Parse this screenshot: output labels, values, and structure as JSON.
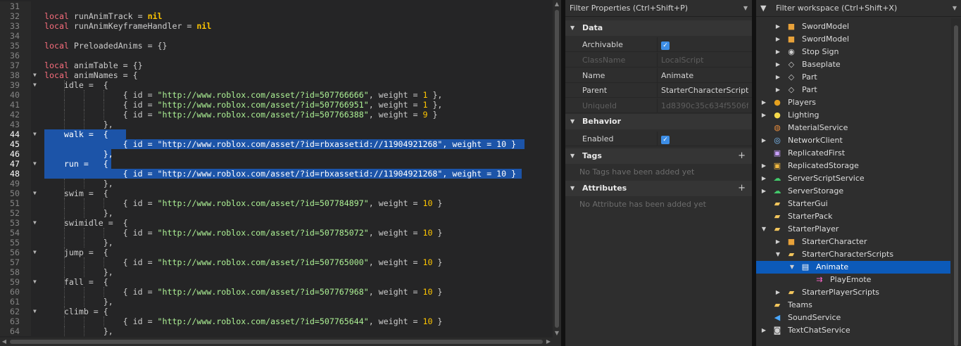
{
  "editor": {
    "lines": [
      {
        "n": "31",
        "fold": "",
        "indent": 0,
        "hl": false,
        "tokens": []
      },
      {
        "n": "32",
        "fold": "",
        "indent": 0,
        "hl": false,
        "tokens": [
          {
            "t": "local",
            "c": "kw"
          },
          {
            "t": " runAnimTrack = ",
            "c": ""
          },
          {
            "t": "nil",
            "c": "nil"
          }
        ]
      },
      {
        "n": "33",
        "fold": "",
        "indent": 0,
        "hl": false,
        "tokens": [
          {
            "t": "local",
            "c": "kw"
          },
          {
            "t": " runAnimKeyframeHandler = ",
            "c": ""
          },
          {
            "t": "nil",
            "c": "nil"
          }
        ]
      },
      {
        "n": "34",
        "fold": "",
        "indent": 0,
        "hl": false,
        "tokens": []
      },
      {
        "n": "35",
        "fold": "",
        "indent": 0,
        "hl": false,
        "tokens": [
          {
            "t": "local",
            "c": "kw"
          },
          {
            "t": " PreloadedAnims = {}",
            "c": ""
          }
        ]
      },
      {
        "n": "36",
        "fold": "",
        "indent": 0,
        "hl": false,
        "tokens": []
      },
      {
        "n": "37",
        "fold": "",
        "indent": 0,
        "hl": false,
        "tokens": [
          {
            "t": "local",
            "c": "kw"
          },
          {
            "t": " animTable = {}",
            "c": ""
          }
        ]
      },
      {
        "n": "38",
        "fold": "▼",
        "indent": 0,
        "hl": false,
        "tokens": [
          {
            "t": "local",
            "c": "kw"
          },
          {
            "t": " animNames = {",
            "c": ""
          }
        ]
      },
      {
        "n": "39",
        "fold": "▼",
        "indent": 1,
        "hl": false,
        "tokens": [
          {
            "t": "    idle =  {",
            "c": ""
          }
        ]
      },
      {
        "n": "40",
        "fold": "",
        "indent": 3,
        "hl": false,
        "tokens": [
          {
            "t": "                { id = ",
            "c": ""
          },
          {
            "t": "\"http://www.roblox.com/asset/?id=507766666\"",
            "c": "str"
          },
          {
            "t": ", weight = ",
            "c": ""
          },
          {
            "t": "1",
            "c": "num"
          },
          {
            "t": " },",
            "c": ""
          }
        ]
      },
      {
        "n": "41",
        "fold": "",
        "indent": 3,
        "hl": false,
        "tokens": [
          {
            "t": "                { id = ",
            "c": ""
          },
          {
            "t": "\"http://www.roblox.com/asset/?id=507766951\"",
            "c": "str"
          },
          {
            "t": ", weight = ",
            "c": ""
          },
          {
            "t": "1",
            "c": "num"
          },
          {
            "t": " },",
            "c": ""
          }
        ]
      },
      {
        "n": "42",
        "fold": "",
        "indent": 3,
        "hl": false,
        "tokens": [
          {
            "t": "                { id = ",
            "c": ""
          },
          {
            "t": "\"http://www.roblox.com/asset/?id=507766388\"",
            "c": "str"
          },
          {
            "t": ", weight = ",
            "c": ""
          },
          {
            "t": "9",
            "c": "num"
          },
          {
            "t": " }",
            "c": ""
          }
        ]
      },
      {
        "n": "43",
        "fold": "",
        "indent": 2,
        "hl": false,
        "tokens": [
          {
            "t": "            },",
            "c": ""
          }
        ]
      },
      {
        "n": "44",
        "fold": "▼",
        "indent": 0,
        "hl": true,
        "hlw": 116,
        "tokens": [
          {
            "t": "    walk =  {",
            "c": ""
          }
        ]
      },
      {
        "n": "45",
        "fold": "",
        "indent": 0,
        "hl": true,
        "hlw": 682,
        "tokens": [
          {
            "t": "                { id = \"http://www.roblox.com/asset/?id=rbxassetid://11904921268\", weight = 10 }",
            "c": ""
          }
        ]
      },
      {
        "n": "46",
        "fold": "",
        "indent": 0,
        "hl": true,
        "hlw": 95,
        "tokens": [
          {
            "t": "            },",
            "c": ""
          }
        ]
      },
      {
        "n": "47",
        "fold": "▼",
        "indent": 0,
        "hl": true,
        "hlw": 95,
        "tokens": [
          {
            "t": "    run =   {",
            "c": ""
          }
        ]
      },
      {
        "n": "48",
        "fold": "",
        "indent": 0,
        "hl": true,
        "hlw": 678,
        "tokens": [
          {
            "t": "                { id = \"http://www.roblox.com/asset/?id=rbxassetid://11904921268\", weight = 10 }",
            "c": ""
          }
        ]
      },
      {
        "n": "49",
        "fold": "",
        "indent": 2,
        "hl": false,
        "tokens": [
          {
            "t": "            },",
            "c": ""
          }
        ]
      },
      {
        "n": "50",
        "fold": "▼",
        "indent": 1,
        "hl": false,
        "tokens": [
          {
            "t": "    swim =  {",
            "c": ""
          }
        ]
      },
      {
        "n": "51",
        "fold": "",
        "indent": 3,
        "hl": false,
        "tokens": [
          {
            "t": "                { id = ",
            "c": ""
          },
          {
            "t": "\"http://www.roblox.com/asset/?id=507784897\"",
            "c": "str"
          },
          {
            "t": ", weight = ",
            "c": ""
          },
          {
            "t": "10",
            "c": "num"
          },
          {
            "t": " }",
            "c": ""
          }
        ]
      },
      {
        "n": "52",
        "fold": "",
        "indent": 2,
        "hl": false,
        "tokens": [
          {
            "t": "            },",
            "c": ""
          }
        ]
      },
      {
        "n": "53",
        "fold": "▼",
        "indent": 1,
        "hl": false,
        "tokens": [
          {
            "t": "    swimidle =  {",
            "c": ""
          }
        ]
      },
      {
        "n": "54",
        "fold": "",
        "indent": 3,
        "hl": false,
        "tokens": [
          {
            "t": "                { id = ",
            "c": ""
          },
          {
            "t": "\"http://www.roblox.com/asset/?id=507785072\"",
            "c": "str"
          },
          {
            "t": ", weight = ",
            "c": ""
          },
          {
            "t": "10",
            "c": "num"
          },
          {
            "t": " }",
            "c": ""
          }
        ]
      },
      {
        "n": "55",
        "fold": "",
        "indent": 2,
        "hl": false,
        "tokens": [
          {
            "t": "            },",
            "c": ""
          }
        ]
      },
      {
        "n": "56",
        "fold": "▼",
        "indent": 1,
        "hl": false,
        "tokens": [
          {
            "t": "    jump =  {",
            "c": ""
          }
        ]
      },
      {
        "n": "57",
        "fold": "",
        "indent": 3,
        "hl": false,
        "tokens": [
          {
            "t": "                { id = ",
            "c": ""
          },
          {
            "t": "\"http://www.roblox.com/asset/?id=507765000\"",
            "c": "str"
          },
          {
            "t": ", weight = ",
            "c": ""
          },
          {
            "t": "10",
            "c": "num"
          },
          {
            "t": " }",
            "c": ""
          }
        ]
      },
      {
        "n": "58",
        "fold": "",
        "indent": 2,
        "hl": false,
        "tokens": [
          {
            "t": "            },",
            "c": ""
          }
        ]
      },
      {
        "n": "59",
        "fold": "▼",
        "indent": 1,
        "hl": false,
        "tokens": [
          {
            "t": "    fall =  {",
            "c": ""
          }
        ]
      },
      {
        "n": "60",
        "fold": "",
        "indent": 3,
        "hl": false,
        "tokens": [
          {
            "t": "                { id = ",
            "c": ""
          },
          {
            "t": "\"http://www.roblox.com/asset/?id=507767968\"",
            "c": "str"
          },
          {
            "t": ", weight = ",
            "c": ""
          },
          {
            "t": "10",
            "c": "num"
          },
          {
            "t": " }",
            "c": ""
          }
        ]
      },
      {
        "n": "61",
        "fold": "",
        "indent": 2,
        "hl": false,
        "tokens": [
          {
            "t": "            },",
            "c": ""
          }
        ]
      },
      {
        "n": "62",
        "fold": "▼",
        "indent": 1,
        "hl": false,
        "tokens": [
          {
            "t": "    climb = {",
            "c": ""
          }
        ]
      },
      {
        "n": "63",
        "fold": "",
        "indent": 3,
        "hl": false,
        "tokens": [
          {
            "t": "                { id = ",
            "c": ""
          },
          {
            "t": "\"http://www.roblox.com/asset/?id=507765644\"",
            "c": "str"
          },
          {
            "t": ", weight = ",
            "c": ""
          },
          {
            "t": "10",
            "c": "num"
          },
          {
            "t": " }",
            "c": ""
          }
        ]
      },
      {
        "n": "64",
        "fold": "",
        "indent": 2,
        "hl": false,
        "tokens": [
          {
            "t": "            },",
            "c": ""
          }
        ]
      }
    ]
  },
  "properties": {
    "filter_placeholder": "Filter Properties (Ctrl+Shift+P)",
    "sections": {
      "data": "Data",
      "behavior": "Behavior",
      "tags": "Tags",
      "attributes": "Attributes"
    },
    "rows": {
      "archivable": {
        "name": "Archivable",
        "checked": true
      },
      "classname": {
        "name": "ClassName",
        "value": "LocalScript"
      },
      "name": {
        "name": "Name",
        "value": "Animate"
      },
      "parent": {
        "name": "Parent",
        "value": "StarterCharacterScripts"
      },
      "uniqueid": {
        "name": "UniqueId",
        "value": "1d8390c35c634f5506f..."
      },
      "enabled": {
        "name": "Enabled",
        "checked": true
      }
    },
    "tags_empty": "No Tags have been added yet",
    "attributes_empty": "No Attribute has been added yet"
  },
  "explorer": {
    "filter_placeholder": "Filter workspace (Ctrl+Shift+X)",
    "items": [
      {
        "label": "SwordModel",
        "depth": 1,
        "arrow": "▶",
        "icon": "model-icon",
        "glyph": "■",
        "color": "#e8a23a"
      },
      {
        "label": "SwordModel",
        "depth": 1,
        "arrow": "▶",
        "icon": "model-icon",
        "glyph": "■",
        "color": "#e8a23a"
      },
      {
        "label": "Stop Sign",
        "depth": 1,
        "arrow": "▶",
        "icon": "union-icon",
        "glyph": "◉",
        "color": "#cfcfcf"
      },
      {
        "label": "Baseplate",
        "depth": 1,
        "arrow": "▶",
        "icon": "part-icon",
        "glyph": "◇",
        "color": "#cfcfcf"
      },
      {
        "label": "Part",
        "depth": 1,
        "arrow": "▶",
        "icon": "part-icon",
        "glyph": "◇",
        "color": "#cfcfcf"
      },
      {
        "label": "Part",
        "depth": 1,
        "arrow": "▶",
        "icon": "part-icon",
        "glyph": "◇",
        "color": "#cfcfcf"
      },
      {
        "label": "Players",
        "depth": 0,
        "arrow": "▶",
        "icon": "players-icon",
        "glyph": "●",
        "color": "#e6a11f"
      },
      {
        "label": "Lighting",
        "depth": 0,
        "arrow": "▶",
        "icon": "lightbulb-icon",
        "glyph": "●",
        "color": "#f5d94a"
      },
      {
        "label": "MaterialService",
        "depth": 0,
        "arrow": "",
        "icon": "material-service-icon",
        "glyph": "◍",
        "color": "#e48a3c"
      },
      {
        "label": "NetworkClient",
        "depth": 0,
        "arrow": "▶",
        "icon": "network-icon",
        "glyph": "◎",
        "color": "#7fc3ff"
      },
      {
        "label": "ReplicatedFirst",
        "depth": 0,
        "arrow": "",
        "icon": "replicated-first-icon",
        "glyph": "▣",
        "color": "#c9a0ff"
      },
      {
        "label": "ReplicatedStorage",
        "depth": 0,
        "arrow": "▶",
        "icon": "replicated-storage-icon",
        "glyph": "▣",
        "color": "#f0b840"
      },
      {
        "label": "ServerScriptService",
        "depth": 0,
        "arrow": "▶",
        "icon": "server-script-service-icon",
        "glyph": "☁",
        "color": "#43c96b"
      },
      {
        "label": "ServerStorage",
        "depth": 0,
        "arrow": "▶",
        "icon": "server-storage-icon",
        "glyph": "☁",
        "color": "#43c96b"
      },
      {
        "label": "StarterGui",
        "depth": 0,
        "arrow": "",
        "icon": "folder-icon",
        "glyph": "▰",
        "color": "#f2c55c"
      },
      {
        "label": "StarterPack",
        "depth": 0,
        "arrow": "",
        "icon": "folder-icon",
        "glyph": "▰",
        "color": "#f2c55c"
      },
      {
        "label": "StarterPlayer",
        "depth": 0,
        "arrow": "▼",
        "icon": "folder-icon",
        "glyph": "▰",
        "color": "#f2c55c"
      },
      {
        "label": "StarterCharacter",
        "depth": 1,
        "arrow": "▶",
        "icon": "model-icon",
        "glyph": "■",
        "color": "#e8a23a"
      },
      {
        "label": "StarterCharacterScripts",
        "depth": 1,
        "arrow": "▼",
        "icon": "folder-icon",
        "glyph": "▰",
        "color": "#f2c55c"
      },
      {
        "label": "Animate",
        "depth": 2,
        "arrow": "▼",
        "icon": "local-script-icon",
        "glyph": "▤",
        "color": "#ffffff",
        "selected": true
      },
      {
        "label": "PlayEmote",
        "depth": 3,
        "arrow": "",
        "icon": "bindable-function-icon",
        "glyph": "⇉",
        "color": "#ff66cc"
      },
      {
        "label": "StarterPlayerScripts",
        "depth": 1,
        "arrow": "▶",
        "icon": "folder-icon",
        "glyph": "▰",
        "color": "#f2c55c"
      },
      {
        "label": "Teams",
        "depth": 0,
        "arrow": "",
        "icon": "teams-icon",
        "glyph": "▰",
        "color": "#f2c55c"
      },
      {
        "label": "SoundService",
        "depth": 0,
        "arrow": "",
        "icon": "sound-icon",
        "glyph": "◀",
        "color": "#4aa8ff"
      },
      {
        "label": "TextChatService",
        "depth": 0,
        "arrow": "▶",
        "icon": "chat-icon",
        "glyph": "◙",
        "color": "#cfcfcf"
      }
    ]
  }
}
